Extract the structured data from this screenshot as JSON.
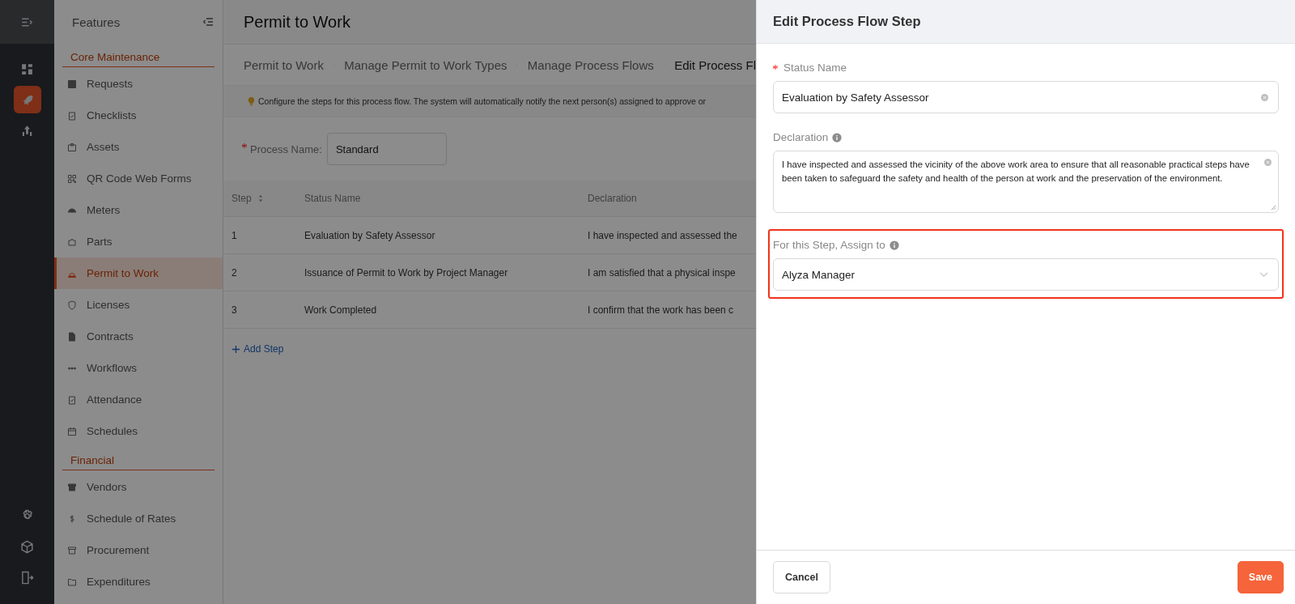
{
  "rail": {
    "items": [
      {
        "selected": false
      },
      {
        "selected": true
      },
      {
        "selected": false
      }
    ]
  },
  "sidebar": {
    "title": "Features",
    "sections": [
      {
        "heading": "Core Maintenance",
        "items": [
          {
            "label": "Requests",
            "selected": false
          },
          {
            "label": "Checklists",
            "selected": false
          },
          {
            "label": "Assets",
            "selected": false
          },
          {
            "label": "QR Code Web Forms",
            "selected": false
          },
          {
            "label": "Meters",
            "selected": false
          },
          {
            "label": "Parts",
            "selected": false
          },
          {
            "label": "Permit to Work",
            "selected": true
          },
          {
            "label": "Licenses",
            "selected": false
          },
          {
            "label": "Contracts",
            "selected": false
          },
          {
            "label": "Workflows",
            "selected": false
          },
          {
            "label": "Attendance",
            "selected": false
          },
          {
            "label": "Schedules",
            "selected": false
          }
        ]
      },
      {
        "heading": "Financial",
        "items": [
          {
            "label": "Vendors",
            "selected": false
          },
          {
            "label": "Schedule of Rates",
            "selected": false
          },
          {
            "label": "Procurement",
            "selected": false
          },
          {
            "label": "Expenditures",
            "selected": false
          }
        ]
      }
    ]
  },
  "page": {
    "title": "Permit to Work",
    "breadcrumb": [
      {
        "label": "Permit to Work",
        "current": false
      },
      {
        "label": "Manage Permit to Work Types",
        "current": false
      },
      {
        "label": "Manage Process Flows",
        "current": false
      },
      {
        "label": "Edit Process Fl",
        "current": true
      }
    ],
    "notice": "Configure the steps for this process flow. The system will automatically notify the next person(s) assigned to approve or",
    "process_name": {
      "label": "Process Name:",
      "required": true,
      "value": "Standard"
    },
    "table": {
      "columns": [
        "Step",
        "Status Name",
        "Declaration"
      ],
      "rows": [
        [
          "1",
          "Evaluation by Safety Assessor",
          "I have inspected and assessed the"
        ],
        [
          "2",
          "Issuance of Permit to Work by Project Manager",
          "I am satisfied that a physical inspe"
        ],
        [
          "3",
          "Work Completed",
          "I confirm that the work has been c"
        ]
      ]
    },
    "add_step": "Add Step"
  },
  "drawer": {
    "title": "Edit Process Flow Step",
    "fields": [
      {
        "kind": "input",
        "label": "Status Name",
        "required": true,
        "info": false,
        "highlighted": false,
        "value": "Evaluation by Safety Assessor"
      },
      {
        "kind": "textarea",
        "label": "Declaration",
        "required": false,
        "info": true,
        "highlighted": false,
        "value": "I have inspected and assessed the vicinity of the above work area to ensure that all reasonable practical steps have been taken to safeguard the safety and health of the person at work and the preservation of the environment."
      },
      {
        "kind": "select",
        "label": "For this Step, Assign to",
        "required": false,
        "info": true,
        "highlighted": true,
        "value": "Alyza Manager"
      }
    ],
    "buttons": [
      {
        "label": "Cancel",
        "kind": "default"
      },
      {
        "label": "Save",
        "kind": "primary"
      }
    ]
  }
}
